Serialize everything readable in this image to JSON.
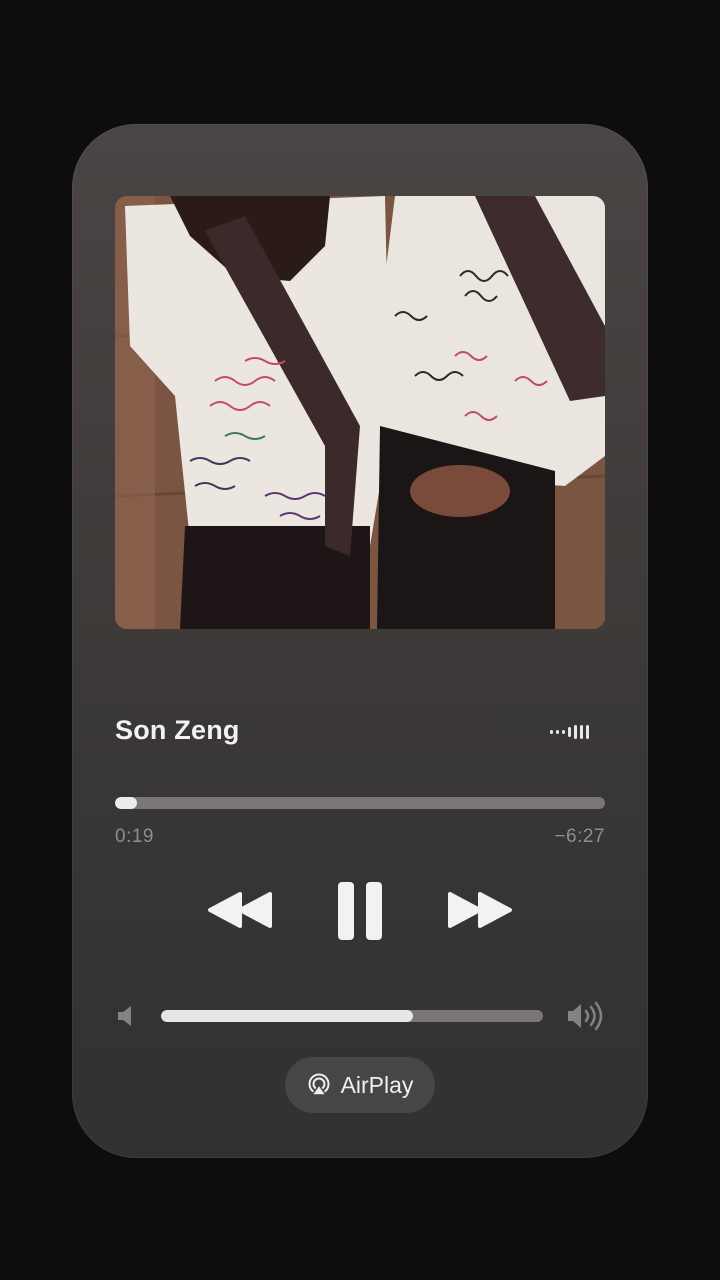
{
  "now_playing": {
    "title": "Son Zeng",
    "artwork_icon": "album-artwork",
    "waveform_icon": "audio-waveform-icon"
  },
  "progress": {
    "elapsed": "0:19",
    "remaining": "−6:27",
    "fraction": 0.045
  },
  "controls": {
    "rewind_icon": "rewind-icon",
    "pause_icon": "pause-icon",
    "forward_icon": "fast-forward-icon"
  },
  "volume": {
    "level": 0.66,
    "low_icon": "speaker-low-icon",
    "high_icon": "speaker-high-icon"
  },
  "airplay": {
    "label": "AirPlay",
    "icon": "airplay-icon"
  },
  "colors": {
    "background": "#0d0d0d",
    "card_top": "#4a4544",
    "card_bottom": "#313131",
    "track": "#7a7677",
    "fill": "#ececec",
    "time_text": "#8f8c8c"
  }
}
